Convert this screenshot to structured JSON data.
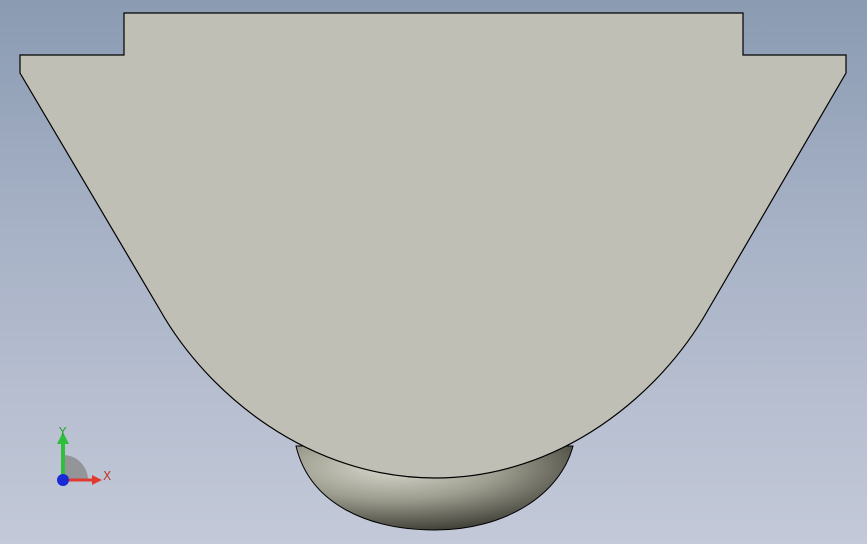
{
  "viewport": {
    "background_top": "#8a9bb2",
    "background_bottom": "#c3c9d8"
  },
  "model": {
    "face_color": "#bfbfb6",
    "edge_color": "#000000",
    "dome_highlight": "#d9d9cf",
    "dome_shadow": "#2c2c25"
  },
  "triad": {
    "x_label": "X",
    "y_label": "Y",
    "x_color": "#e03a2f",
    "y_color": "#2fbf3a",
    "z_color": "#1a2bd6"
  }
}
